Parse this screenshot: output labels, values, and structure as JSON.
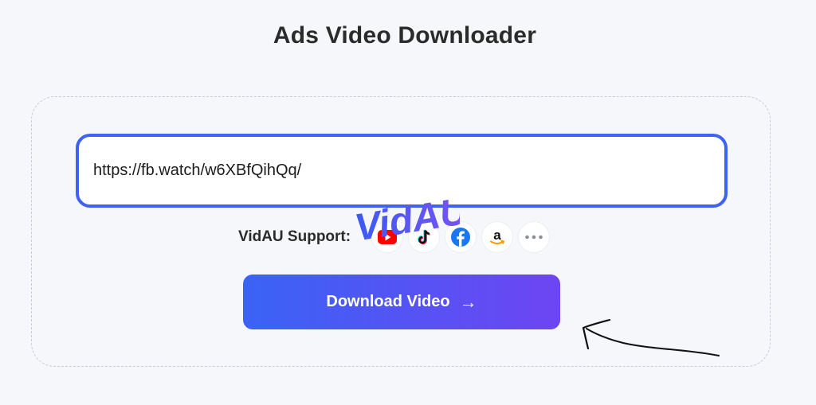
{
  "page": {
    "title": "Ads Video Downloader"
  },
  "url_input": {
    "value": "https://fb.watch/w6XBfQihQq/"
  },
  "watermark": {
    "text": "VidAU"
  },
  "support": {
    "label": "VidAU Support:",
    "platforms": [
      "youtube",
      "tiktok",
      "facebook",
      "amazon",
      "more"
    ]
  },
  "download_button": {
    "label": "Download Video",
    "arrow": "→"
  },
  "colors": {
    "accent_blue": "#3d63f2",
    "button_gradient_start": "#3a63f5",
    "button_gradient_end": "#6d45f2",
    "background": "#f6f7fb"
  }
}
